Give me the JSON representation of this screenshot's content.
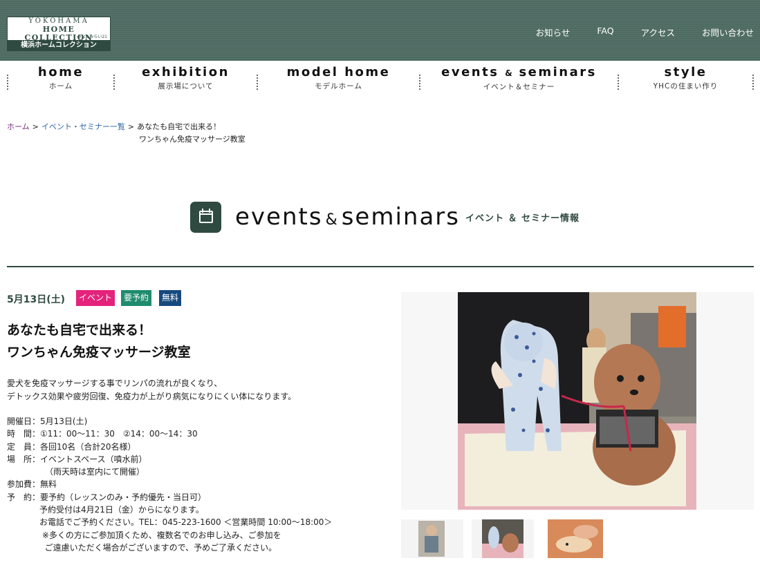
{
  "header": {
    "logo": {
      "line1": "YOKOHAMA",
      "line2": "HOME COLLECTION",
      "line3": "みなとみらい21",
      "line4": "横浜ホームコレクション"
    },
    "util_nav": [
      "お知らせ",
      "FAQ",
      "アクセス",
      "お問い合わせ"
    ]
  },
  "main_nav": [
    {
      "en": "home",
      "jp": "ホーム"
    },
    {
      "en": "exhibition",
      "jp": "展示場について"
    },
    {
      "en": "model home",
      "jp": "モデルホーム"
    },
    {
      "en_a": "events",
      "en_amp": "&",
      "en_b": "seminars",
      "jp": "イベント＆セミナー"
    },
    {
      "en": "style",
      "jp": "YHCの住まい作り"
    }
  ],
  "breadcrumb": {
    "home": "ホーム",
    "sep": ">",
    "list": "イベント・セミナー一覧",
    "current_line1": "あなたも自宅で出来る！",
    "current_line2": "ワンちゃん免疫マッサージ教室"
  },
  "section": {
    "en_a": "events",
    "en_amp": "&",
    "en_b": "seminars",
    "jp": "イベント ＆ セミナー情報"
  },
  "event": {
    "date": "5月13日(土)",
    "tags": [
      "イベント",
      "要予約",
      "無料"
    ],
    "title_line1": "あなたも自宅で出来る！",
    "title_line2": "ワンちゃん免疫マッサージ教室",
    "desc_line1": "愛犬を免疫マッサージする事でリンパの流れが良くなり、",
    "desc_line2": "デトックス効果や疲労回復、免疫力が上がり病気になりにくい体になります。",
    "info": {
      "date_k": "開催日：",
      "date_v": "5月13日(土)",
      "time_k": "時　間：",
      "time_v": "①11：00～11：30　②14：00～14：30",
      "cap_k": "定　員：",
      "cap_v": "各回10名（合計20名様）",
      "place_k": "場　所：",
      "place_v": "イベントスペース（噴水前）",
      "place_v2": "（雨天時は室内にて開催）",
      "fee_k": "参加費：",
      "fee_v": "無料",
      "res_k": "予　約：",
      "res_v": "要予約（レッスンのみ・予約優先・当日可）",
      "res_v2": "予約受付は4月21日（金）からになります。",
      "res_v3": "お電話でご予約ください。TEL：045-223-1600 ＜営業時間 10:00～18:00＞",
      "res_v4": " ※多くの方にご参加頂くため、複数名でのお申し込み、ご参加を",
      "res_v5": "  ご遠慮いただく場合がございますので、予めご了承ください。"
    }
  }
}
